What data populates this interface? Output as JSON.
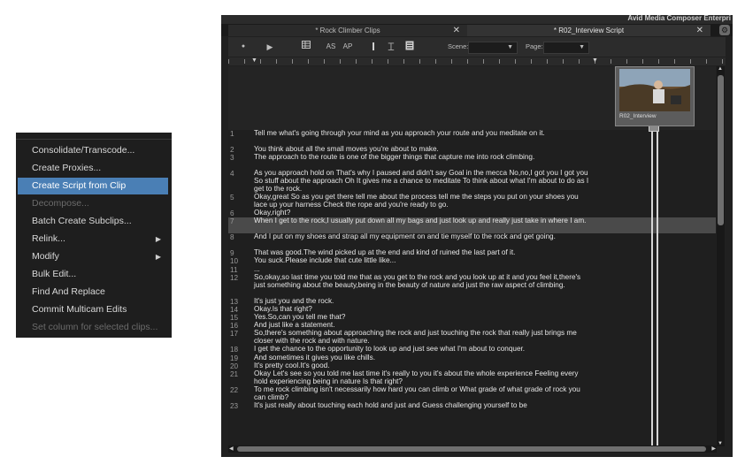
{
  "context_menu": {
    "items": [
      {
        "label": "Consolidate/Transcode...",
        "state": "normal",
        "submenu": false
      },
      {
        "label": "Create Proxies...",
        "state": "normal",
        "submenu": false
      },
      {
        "label": "Create Script from Clip",
        "state": "highlighted",
        "submenu": false
      },
      {
        "label": "Decompose...",
        "state": "disabled",
        "submenu": false
      },
      {
        "label": "Batch Create Subclips...",
        "state": "normal",
        "submenu": false
      },
      {
        "label": "Relink...",
        "state": "normal",
        "submenu": true
      },
      {
        "label": "Modify",
        "state": "normal",
        "submenu": true
      },
      {
        "label": "Bulk Edit...",
        "state": "normal",
        "submenu": false
      },
      {
        "label": "Find And Replace",
        "state": "normal",
        "submenu": false
      },
      {
        "label": "Commit Multicam Edits",
        "state": "normal",
        "submenu": false
      },
      {
        "label": "Set column for selected clips...",
        "state": "disabled",
        "submenu": false
      }
    ],
    "submenu_arrow": "▶"
  },
  "app_title": "Avid Media Composer Enterpri",
  "tabs": [
    {
      "label": "* Rock Climber Clips",
      "close": "✕"
    },
    {
      "label": "* R02_Interview Script",
      "close": "✕"
    }
  ],
  "toolbar": {
    "as": "AS",
    "ap": "AP",
    "scene_label": "Scene:",
    "page_label": "Page:",
    "scene_value": "",
    "page_value": ""
  },
  "thumbnail_caption": "R02_Interview",
  "script_lines": [
    {
      "n": "1",
      "text": "Tell me what's going through your mind as you approach your route and you meditate on it."
    },
    {
      "n": "2",
      "text": "You think about all the small moves you're about to make."
    },
    {
      "n": "3",
      "text": "The approach to the route is one of the bigger things that capture me into rock climbing."
    },
    {
      "n": "4",
      "text": "As you approach hold on That's why I paused and didn't say Goal in the mecca No,no,I got you I got you So stuff about the approach Oh It gives me a chance to meditate To think about what I'm about to do as I get to the rock."
    },
    {
      "n": "5",
      "text": "Okay,great So as you get there tell me about the process tell me the steps you put on your shoes you lace up your harness Check the rope and you're ready to go."
    },
    {
      "n": "6",
      "text": "Okay,right?"
    },
    {
      "n": "7",
      "text": "When I get to the rock,I usually put down all my bags and just look up and really just take in where I am."
    },
    {
      "n": "8",
      "text": "And I put on my shoes and strap all my equipment on and tie myself to the rock and get going."
    },
    {
      "n": "9",
      "text": "That was good.The wind picked up at the end and kind of ruined the last part of it."
    },
    {
      "n": "10",
      "text": "You suck.Please include that cute little like..."
    },
    {
      "n": "11",
      "text": "..."
    },
    {
      "n": "12",
      "text": "So,okay,so last time you told me that as you get to the rock and you look up at it and you feel it,there's just something about the beauty,being in the beauty of nature and just the raw aspect of climbing."
    },
    {
      "n": "13",
      "text": "It's just you and the rock."
    },
    {
      "n": "14",
      "text": "Okay.Is that right?"
    },
    {
      "n": "15",
      "text": "Yes.So,can you tell me that?"
    },
    {
      "n": "16",
      "text": "And just like a statement."
    },
    {
      "n": "17",
      "text": "So,there's something about approaching the rock and just touching the rock that really just brings me closer with the rock and with nature."
    },
    {
      "n": "18",
      "text": "I get the chance to the opportunity to look up and just see what I'm about to conquer."
    },
    {
      "n": "19",
      "text": "And sometimes it gives you like chills."
    },
    {
      "n": "20",
      "text": "It's pretty cool.It's good."
    },
    {
      "n": "21",
      "text": "Okay Let's see so you told me last time it's really to you it's about the whole experience Feeling every hold experiencing being in nature Is that right?"
    },
    {
      "n": "22",
      "text": "To me rock climbing isn't necessarily how hard you can climb or What grade of what grade of rock you can climb?"
    },
    {
      "n": "23",
      "text": "It's just really about touching each hold and just and Guess challenging yourself to be"
    }
  ],
  "icons": {
    "gear": "gear-icon",
    "record": "record-icon",
    "play": "play-icon",
    "grid": "grid-icon",
    "ibeam": "ibeam-icon",
    "doc": "document-icon",
    "caret": "▼",
    "scroll_up": "▲",
    "scroll_down": "▼",
    "scroll_left": "◀",
    "scroll_right": "▶"
  },
  "colors": {
    "menu_highlight": "#4a7fb5",
    "selected_line": "#4a4a4a"
  }
}
